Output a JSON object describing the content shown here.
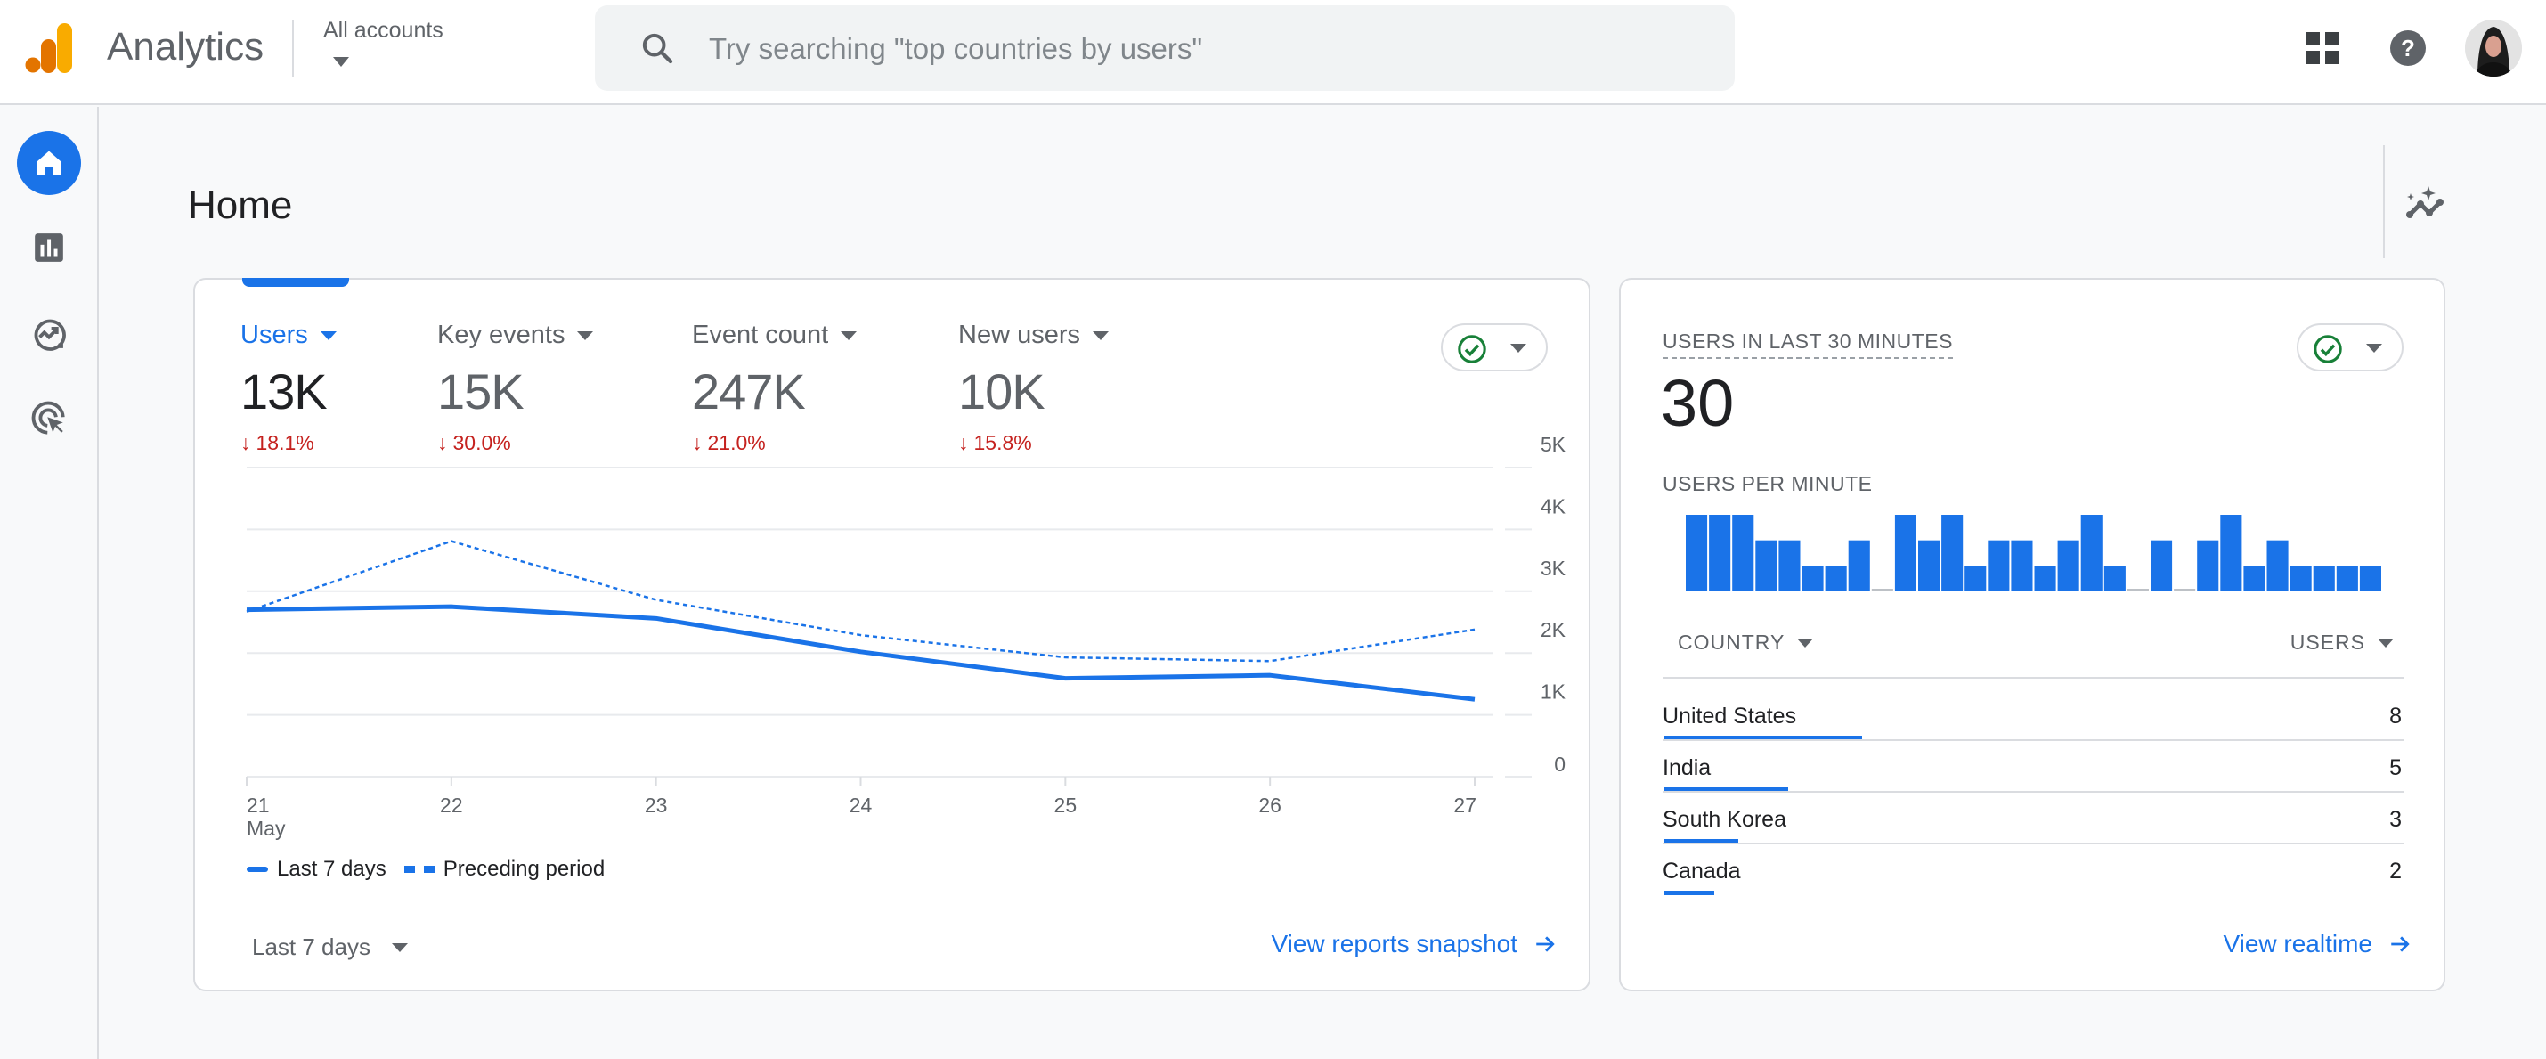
{
  "header": {
    "app_title": "Analytics",
    "account_selector": "All accounts",
    "search_placeholder": "Try searching \"top countries by users\"",
    "icons": [
      "apps-grid-icon",
      "help-icon",
      "avatar"
    ]
  },
  "sidebar": {
    "items": [
      {
        "name": "home",
        "icon": "home-icon",
        "active": true
      },
      {
        "name": "reports",
        "icon": "bar-chart-icon",
        "active": false
      },
      {
        "name": "explore",
        "icon": "explore-trend-icon",
        "active": false
      },
      {
        "name": "advertising",
        "icon": "target-cursor-icon",
        "active": false
      }
    ]
  },
  "page": {
    "title": "Home",
    "insights_icon": "insights-sparkle-icon"
  },
  "overview_card": {
    "metrics": [
      {
        "label": "Users",
        "value": "13K",
        "change": "18.1%",
        "direction": "down",
        "active": true
      },
      {
        "label": "Key events",
        "value": "15K",
        "change": "30.0%",
        "direction": "down",
        "active": false
      },
      {
        "label": "Event count",
        "value": "247K",
        "change": "21.0%",
        "direction": "down",
        "active": false
      },
      {
        "label": "New users",
        "value": "10K",
        "change": "15.8%",
        "direction": "down",
        "active": false
      }
    ],
    "status_icon": "check-circle-icon",
    "range_label": "Last 7 days",
    "link_label": "View reports snapshot"
  },
  "realtime_card": {
    "title": "USERS IN LAST 30 MINUTES",
    "value": "30",
    "subtitle": "USERS PER MINUTE",
    "status_icon": "check-circle-icon",
    "table": {
      "col_country": "COUNTRY",
      "col_users": "USERS",
      "rows": [
        {
          "country": "United States",
          "users": 8
        },
        {
          "country": "India",
          "users": 5
        },
        {
          "country": "South Korea",
          "users": 3
        },
        {
          "country": "Canada",
          "users": 2
        }
      ]
    },
    "link_label": "View realtime"
  },
  "chart_data": [
    {
      "type": "line",
      "title": "Users",
      "x": [
        "21",
        "22",
        "23",
        "24",
        "25",
        "26",
        "27"
      ],
      "x_sublabel": "May",
      "y_ticks": [
        "0",
        "1K",
        "2K",
        "3K",
        "4K",
        "5K"
      ],
      "ylim": [
        0,
        5000
      ],
      "grid": true,
      "y_axis_side": "right",
      "series": [
        {
          "name": "Last 7 days",
          "style": "solid",
          "color": "#1a73e8",
          "values": [
            2700,
            2750,
            2560,
            2020,
            1590,
            1640,
            1250
          ]
        },
        {
          "name": "Preceding period",
          "style": "dashed",
          "color": "#1a73e8",
          "values": [
            2670,
            3810,
            2860,
            2290,
            1930,
            1870,
            2380
          ]
        }
      ],
      "legend": "bottom-left"
    },
    {
      "type": "bar",
      "title": "USERS PER MINUTE",
      "categories": [
        "1",
        "2",
        "3",
        "4",
        "5",
        "6",
        "7",
        "8",
        "9",
        "10",
        "11",
        "12",
        "13",
        "14",
        "15",
        "16",
        "17",
        "18",
        "19",
        "20",
        "21",
        "22",
        "23",
        "24",
        "25",
        "26",
        "27",
        "28",
        "29",
        "30"
      ],
      "values": [
        3,
        3,
        3,
        2,
        2,
        1,
        1,
        2,
        0,
        3,
        2,
        3,
        1,
        2,
        2,
        1,
        2,
        3,
        1,
        0,
        2,
        0,
        2,
        3,
        1,
        2,
        1,
        1,
        1,
        1
      ],
      "ylim": [
        0,
        3
      ],
      "color": "#1a73e8",
      "zero_color": "#bdc1c6"
    },
    {
      "type": "bar",
      "title": "Users by country",
      "categories": [
        "United States",
        "India",
        "South Korea",
        "Canada"
      ],
      "values": [
        8,
        5,
        3,
        2
      ],
      "orientation": "horizontal"
    }
  ]
}
